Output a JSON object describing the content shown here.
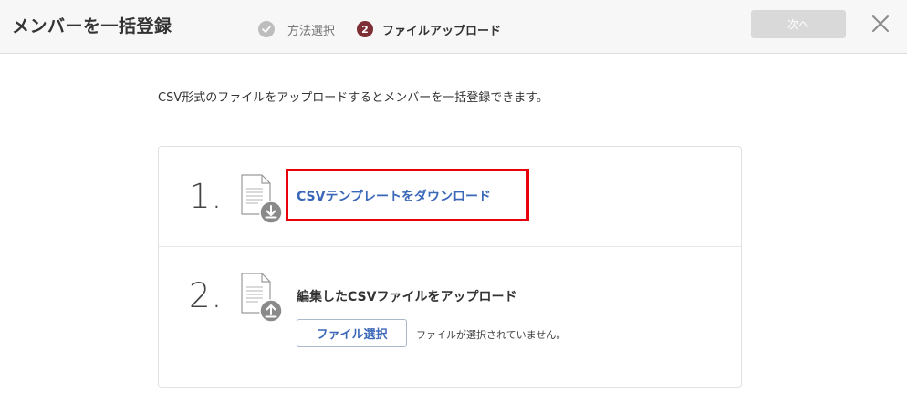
{
  "header": {
    "title": "メンバーを一括登録",
    "steps": [
      {
        "label": "方法選択",
        "state": "done"
      },
      {
        "number": "2",
        "label": "ファイルアップロード",
        "state": "current"
      }
    ],
    "next_label": "次へ",
    "close_icon": "close-icon"
  },
  "intro": "CSV形式のファイルをアップロードするとメンバーを一括登録できます。",
  "card": {
    "download": {
      "number": "1.",
      "link_label": "CSVテンプレートをダウンロード",
      "icon": "file-download-icon"
    },
    "upload": {
      "number": "2.",
      "title": "編集したCSVファイルをアップロード",
      "button_label": "ファイル選択",
      "status": "ファイルが選択されていません。",
      "icon": "file-upload-icon"
    }
  },
  "colors": {
    "accent": "#3a67b8",
    "current_step": "#7d2f35",
    "highlight": "#e8000b",
    "disabled_button": "#d9d9d9"
  }
}
